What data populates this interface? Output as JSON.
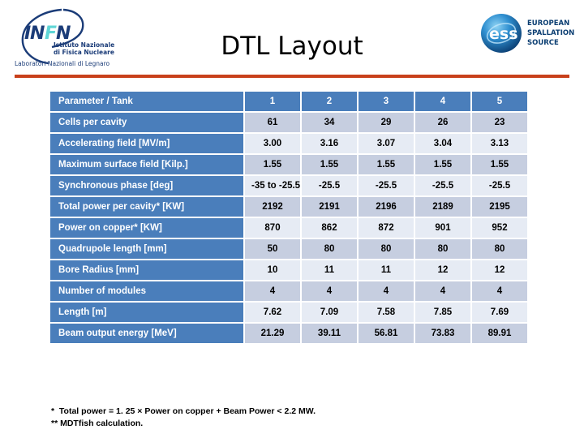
{
  "header": {
    "title": "DTL Layout",
    "divider_color": "#c8401b",
    "left_logo": {
      "name": "infn-logo",
      "acronym": "INFN",
      "line1": "Istituto Nazionale",
      "line2": "di Fisica Nucleare",
      "line3": "Laboratori Nazionali di Legnaro"
    },
    "right_logo": {
      "name": "ess-logo",
      "acronym": "ess",
      "line1": "EUROPEAN",
      "line2": "SPALLATION",
      "line3": "SOURCE"
    }
  },
  "table": {
    "header_bg": "#4a7ebb",
    "band_a_bg": "#c6cee0",
    "band_b_bg": "#e6ebf4",
    "columns": [
      "Parameter / Tank",
      "1",
      "2",
      "3",
      "4",
      "5"
    ],
    "rows": [
      {
        "label": "Cells per cavity",
        "values": [
          "61",
          "34",
          "29",
          "26",
          "23"
        ]
      },
      {
        "label": "Accelerating field [MV/m]",
        "values": [
          "3.00",
          "3.16",
          "3.07",
          "3.04",
          "3.13"
        ]
      },
      {
        "label": "Maximum surface field [Kilp.]",
        "values": [
          "1.55",
          "1.55",
          "1.55",
          "1.55",
          "1.55"
        ]
      },
      {
        "label": "Synchronous phase [deg]",
        "values": [
          "-35 to -25.5",
          "-25.5",
          "-25.5",
          "-25.5",
          "-25.5"
        ]
      },
      {
        "label": "Total power per cavity* [KW]",
        "values": [
          "2192",
          "2191",
          "2196",
          "2189",
          "2195"
        ]
      },
      {
        "label": "Power on copper* [KW]",
        "values": [
          "870",
          "862",
          "872",
          "901",
          "952"
        ]
      },
      {
        "label": "Quadrupole length [mm]",
        "values": [
          "50",
          "80",
          "80",
          "80",
          "80"
        ]
      },
      {
        "label": "Bore Radius [mm]",
        "values": [
          "10",
          "11",
          "11",
          "12",
          "12"
        ]
      },
      {
        "label": "Number of modules",
        "values": [
          "4",
          "4",
          "4",
          "4",
          "4"
        ]
      },
      {
        "label": "Length [m]",
        "values": [
          "7.62",
          "7.09",
          "7.58",
          "7.85",
          "7.69"
        ]
      },
      {
        "label": "Beam output energy [MeV]",
        "values": [
          "21.29",
          "39.11",
          "56.81",
          "73.83",
          "89.91"
        ]
      }
    ]
  },
  "footnotes": {
    "line1": "*  Total power = 1. 25 × Power on copper + Beam Power < 2.2 MW.",
    "line2": "** MDTfish calculation."
  }
}
